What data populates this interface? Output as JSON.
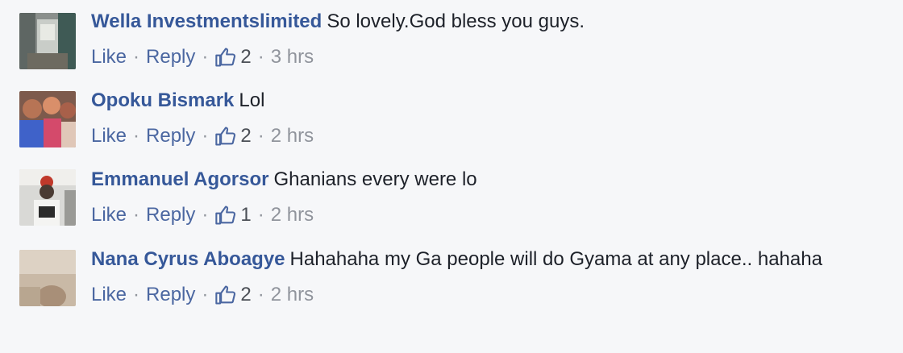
{
  "comments": [
    {
      "author": "Wella Investmentslimited",
      "text": "So lovely.God bless you guys.",
      "like_label": "Like",
      "reply_label": "Reply",
      "likes": "2",
      "time": "3 hrs",
      "avatar_icon": "profile-photo"
    },
    {
      "author": "Opoku Bismark",
      "text": "Lol",
      "like_label": "Like",
      "reply_label": "Reply",
      "likes": "2",
      "time": "2 hrs",
      "avatar_icon": "profile-photo"
    },
    {
      "author": "Emmanuel Agorsor",
      "text": "Ghanians every were lo",
      "like_label": "Like",
      "reply_label": "Reply",
      "likes": "1",
      "time": "2 hrs",
      "avatar_icon": "profile-photo"
    },
    {
      "author": "Nana Cyrus Aboagye",
      "text": "Hahahaha my Ga people will do Gyama at any place.. hahaha",
      "like_label": "Like",
      "reply_label": "Reply",
      "likes": "2",
      "time": "2 hrs",
      "avatar_icon": "profile-photo"
    }
  ],
  "separator": "·",
  "colors": {
    "background": "#f6f7f9",
    "author": "#365899",
    "link": "#4b67a1",
    "meta": "#90949c",
    "text": "#1d2129"
  }
}
